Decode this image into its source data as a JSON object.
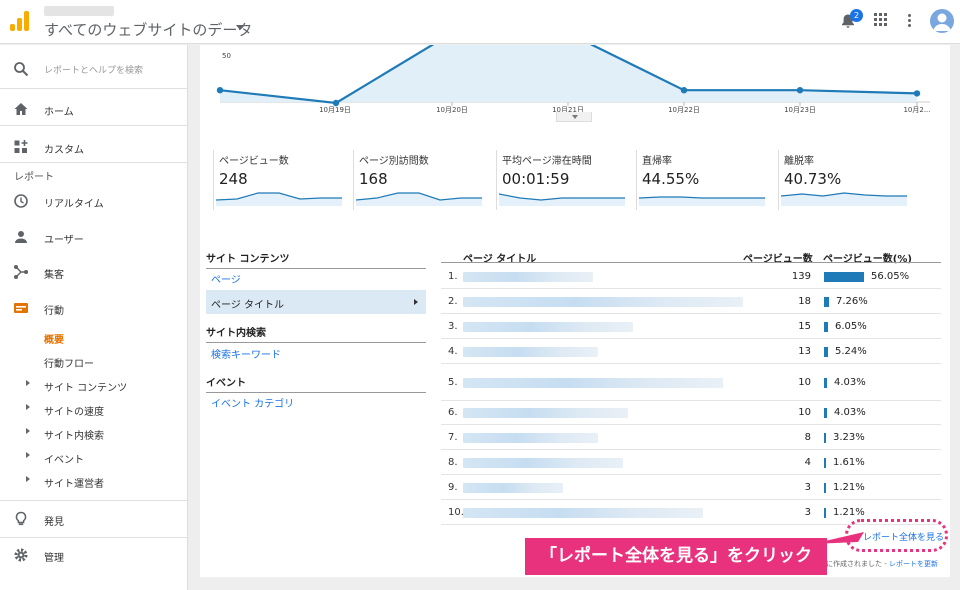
{
  "header": {
    "property": "すべてのウェブサイトのデータ",
    "notification_count": "2"
  },
  "sidebar": {
    "search_placeholder": "レポートとヘルプを検索",
    "home": "ホーム",
    "custom": "カスタム",
    "reports_heading": "レポート",
    "realtime": "リアルタイム",
    "users": "ユーザー",
    "acquisition": "集客",
    "behavior": "行動",
    "behavior_sub": {
      "overview": "概要",
      "flow": "行動フロー",
      "site_content": "サイト コンテンツ",
      "site_speed": "サイトの速度",
      "site_search": "サイト内検索",
      "events": "イベント",
      "publisher": "サイト運営者"
    },
    "discover": "発見",
    "admin": "管理"
  },
  "chart": {
    "y_tick": "50",
    "x_labels": [
      "10月19日",
      "10月20日",
      "10月21日",
      "10月22日",
      "10月23日",
      "10月2..."
    ],
    "values": [
      38,
      30,
      70,
      70,
      38,
      38,
      36
    ]
  },
  "metrics": [
    {
      "label": "ページビュー数",
      "value": "248"
    },
    {
      "label": "ページ別訪問数",
      "value": "168"
    },
    {
      "label": "平均ページ滞在時間",
      "value": "00:01:59"
    },
    {
      "label": "直帰率",
      "value": "44.55%"
    },
    {
      "label": "離脱率",
      "value": "40.73%"
    }
  ],
  "report_nav": {
    "site_content": "サイト コンテンツ",
    "page": "ページ",
    "page_title": "ページ タイトル",
    "site_search": "サイト内検索",
    "search_keyword": "検索キーワード",
    "event": "イベント",
    "event_category": "イベント カテゴリ"
  },
  "table": {
    "col_title": "ページ タイトル",
    "col_pv": "ページビュー数",
    "col_pct": "ページビュー数(%)",
    "rows": [
      {
        "idx": "1.",
        "pv": "139",
        "pct": "56.05%",
        "frac": 0.5605
      },
      {
        "idx": "2.",
        "pv": "18",
        "pct": "7.26%",
        "frac": 0.0726
      },
      {
        "idx": "3.",
        "pv": "15",
        "pct": "6.05%",
        "frac": 0.0605
      },
      {
        "idx": "4.",
        "pv": "13",
        "pct": "5.24%",
        "frac": 0.0524
      },
      {
        "idx": "5.",
        "pv": "10",
        "pct": "4.03%",
        "frac": 0.0403
      },
      {
        "idx": "6.",
        "pv": "10",
        "pct": "4.03%",
        "frac": 0.0403
      },
      {
        "idx": "7.",
        "pv": "8",
        "pct": "3.23%",
        "frac": 0.0323
      },
      {
        "idx": "8.",
        "pv": "4",
        "pct": "1.61%",
        "frac": 0.0161
      },
      {
        "idx": "9.",
        "pv": "3",
        "pct": "1.21%",
        "frac": 0.0121
      },
      {
        "idx": "10.",
        "pv": "3",
        "pct": "1.21%",
        "frac": 0.0121
      }
    ]
  },
  "full_report_link": "レポート全体を見る",
  "callout": "「レポート全体を見る」をクリック",
  "footer": {
    "note": "に作成されました -",
    "refresh": "レポートを更新"
  },
  "colors": {
    "accent": "#1a73e8",
    "bar": "#1f7ab8",
    "callout": "#e8327e",
    "active": "#e37400"
  }
}
